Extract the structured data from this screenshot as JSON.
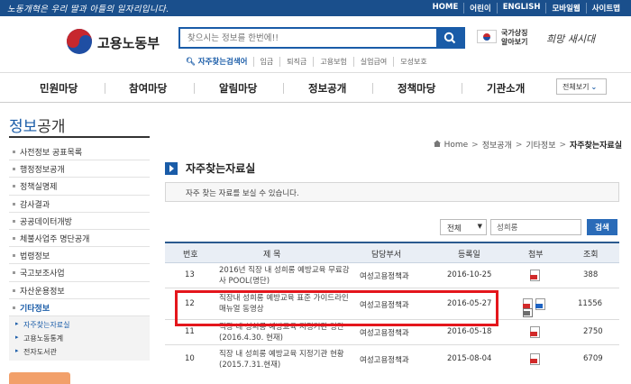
{
  "topbar": {
    "slogan": "노동개혁은 우리 딸과 아들의 일자리입니다.",
    "links": [
      "HOME",
      "어린이",
      "ENGLISH",
      "모바일웹",
      "사이트맵"
    ]
  },
  "header": {
    "logo_text": "고용노동부",
    "search_placeholder": "찾으시는 정보를 한번에!!",
    "popular_label": "자주찾는검색어",
    "popular_keywords": [
      "임금",
      "퇴직금",
      "고용보험",
      "실업급여",
      "모성보호"
    ],
    "flag_text_1": "국가상징",
    "flag_text_2": "알아보기",
    "slogan_sign": "희망 새시대"
  },
  "gnb": {
    "menus": [
      "민원마당",
      "참여마당",
      "알림마당",
      "정보공개",
      "정책마당",
      "기관소개"
    ],
    "view_all": "전체보기"
  },
  "sidebar": {
    "title_hl": "정보",
    "title_rest": "공개",
    "items": [
      "사전정보 공표목록",
      "행정정보공개",
      "정책실명제",
      "감사결과",
      "공공데이터개방",
      "체불사업주 명단공개",
      "법령정보",
      "국고보조사업",
      "자산운용정보",
      "기타정보"
    ],
    "active_index": 9,
    "sub_items": [
      "자주찾는자료실",
      "고용노동통계",
      "전자도서관"
    ]
  },
  "breadcrumb": {
    "home": "Home",
    "items": [
      "정보공개",
      "기타정보"
    ],
    "current": "자주찾는자료실"
  },
  "page": {
    "title": "자주찾는자료실",
    "description": "자주 찾는 자료를 보실 수 있습니다."
  },
  "search": {
    "filter_value": "전체",
    "keyword_value": "성희롱",
    "button": "검색"
  },
  "table": {
    "headers": [
      "번호",
      "제 목",
      "담당부서",
      "등록일",
      "첨부",
      "조회"
    ],
    "rows": [
      {
        "no": "13",
        "title": "2016년 직장 내 성희롱 예방교육 무료강사 POOL(명단)",
        "dept": "여성고용정책과",
        "date": "2016-10-25",
        "attach": [
          "pdf"
        ],
        "views": "388"
      },
      {
        "no": "12",
        "title": "직장내 성희롱 예방교육 표준 가이드라인 매뉴얼 동영상",
        "dept": "여성고용정책과",
        "date": "2016-05-27",
        "attach": [
          "pdf",
          "hwp",
          "mov"
        ],
        "views": "11556"
      },
      {
        "no": "11",
        "title": "직장 내 성희롱 예방교육 지정기관 명단(2016.4.30. 현재)",
        "dept": "여성고용정책과",
        "date": "2016-05-18",
        "attach": [
          "pdf"
        ],
        "views": "2750"
      },
      {
        "no": "10",
        "title": "직장 내 성희롱 예방교육 지정기관 현황(2015.7.31.현재)",
        "dept": "여성고용정책과",
        "date": "2015-08-04",
        "attach": [
          "pdf"
        ],
        "views": "6709"
      }
    ]
  },
  "colors": {
    "brand_blue": "#1a5ca8",
    "topbar": "#1a4f8c",
    "highlight_red": "#e4161c"
  }
}
